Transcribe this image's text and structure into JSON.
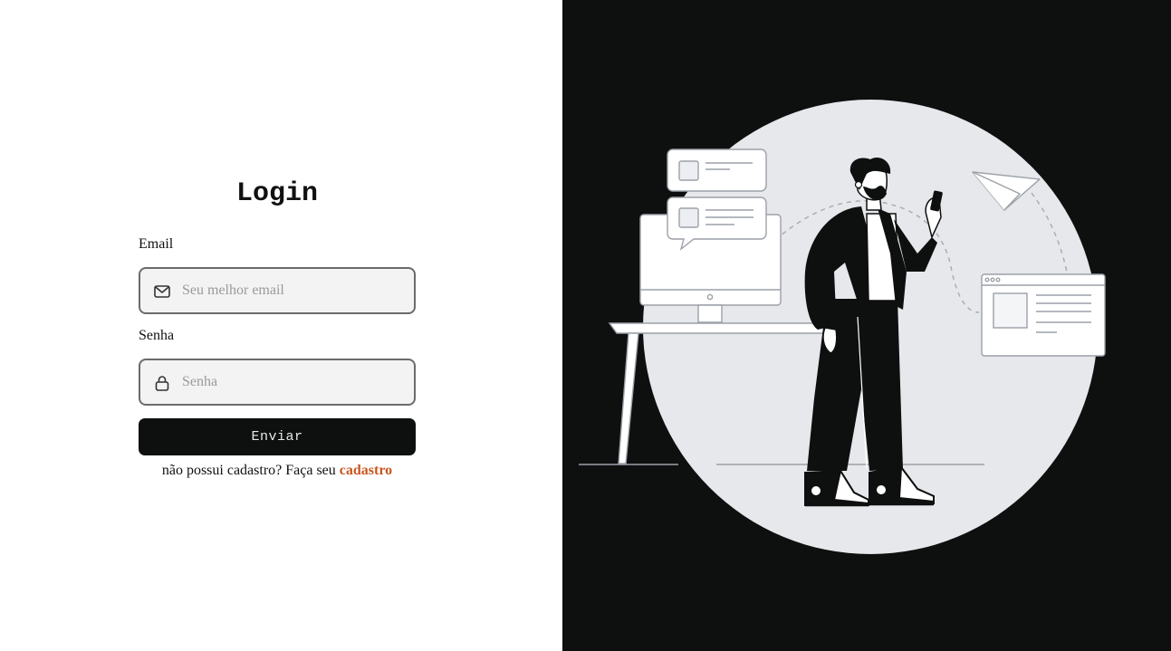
{
  "login": {
    "title": "Login",
    "email": {
      "label": "Email",
      "placeholder": "Seu melhor email",
      "value": ""
    },
    "password": {
      "label": "Senha",
      "placeholder": "Senha",
      "value": ""
    },
    "submit_label": "Enviar",
    "signup_prompt": "não possui cadastro? Faça seu",
    "signup_link": "cadastro"
  },
  "colors": {
    "panel_dark": "#0e0f0f",
    "input_bg": "#f3f3f3",
    "link": "#c8561e",
    "circle": "#e6e8eb"
  },
  "icons": [
    "mail-icon",
    "lock-icon"
  ]
}
